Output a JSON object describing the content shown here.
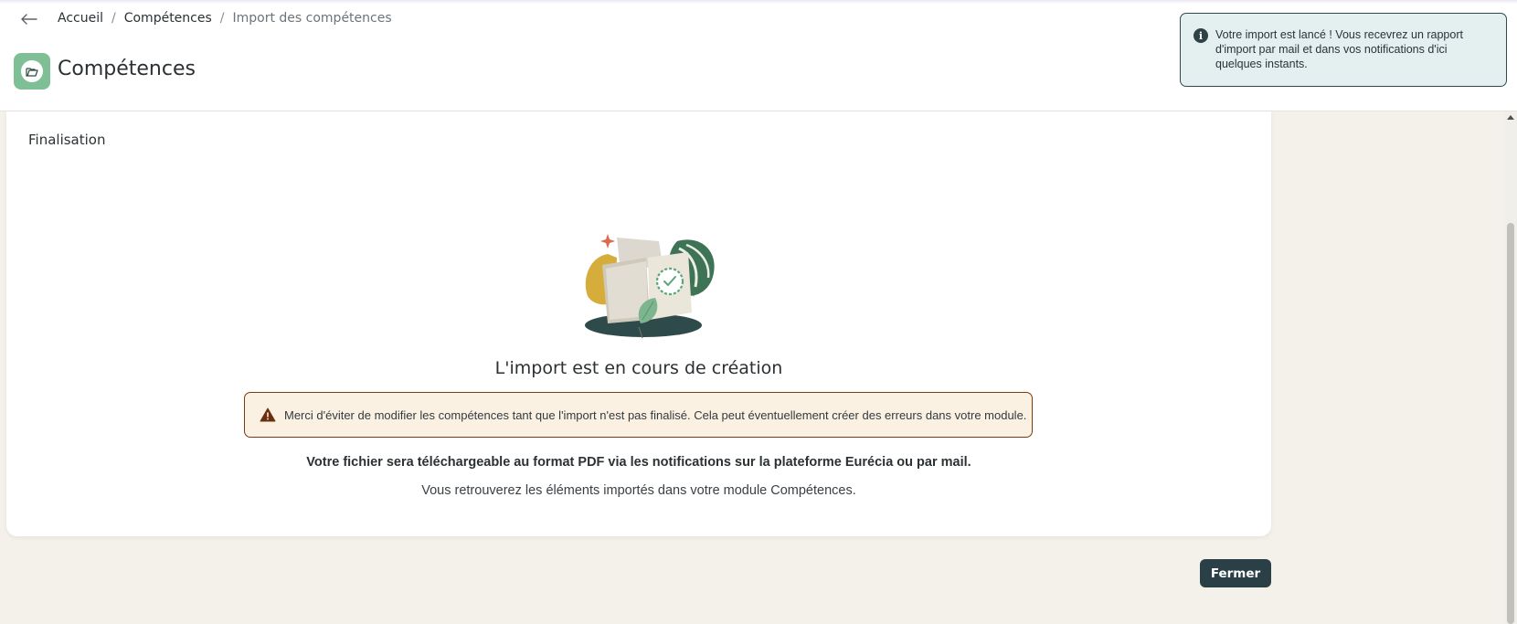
{
  "header": {
    "back_icon": "arrow-left-icon",
    "breadcrumb": [
      {
        "label": "Accueil"
      },
      {
        "label": "Compétences"
      },
      {
        "label": "Import des compétences"
      }
    ],
    "separator": "/",
    "app_icon": "folder-open-icon",
    "title": "Compétences"
  },
  "toast": {
    "icon": "info-icon",
    "message": "Votre import est lancé ! Vous recevrez un rapport d'import par mail et dans vos notifications d'ici quelques instants."
  },
  "card": {
    "step_label": "Finalisation",
    "illustration": "book-with-badge-illustration",
    "heading": "L'import est en cours de création",
    "warning": {
      "icon": "warning-triangle-icon",
      "text": "Merci d'éviter de modifier les compétences tant que l'import n'est pas finalisé. Cela peut éventuellement créer des erreurs dans votre module."
    },
    "info_bold": "Votre fichier sera téléchargeable au format PDF via les notifications sur la plateforme Eurécia ou par mail.",
    "info_regular": "Vous retrouverez les éléments importés dans votre module Compétences."
  },
  "footer": {
    "close_label": "Fermer"
  },
  "colors": {
    "accent_dark": "#2b3f46",
    "app_icon_green": "#7fbf96",
    "warning_border": "#7a3a10",
    "warning_bg": "#fbf1e3",
    "toast_bg": "#e4eff0",
    "page_bg": "#f4f1ea"
  }
}
